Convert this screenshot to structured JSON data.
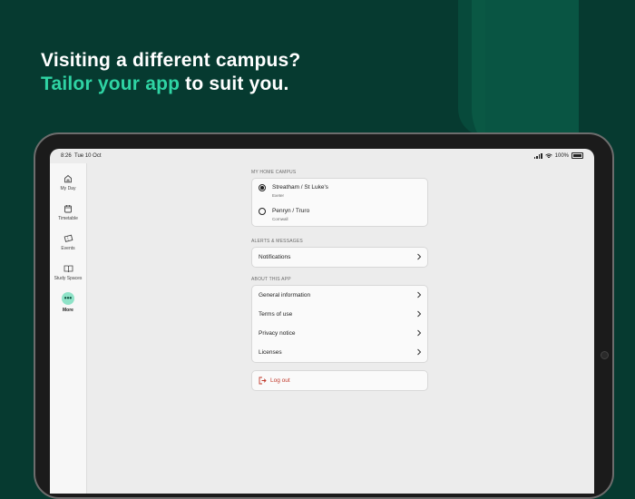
{
  "headline": {
    "line1": "Visiting a different campus?",
    "accent": "Tailor your app",
    "line2_rest": " to suit you."
  },
  "statusbar": {
    "time": "8:26",
    "date": "Tue 10 Oct",
    "battery": "100%"
  },
  "sidebar": {
    "items": [
      {
        "label": "My Day",
        "icon": "home-icon"
      },
      {
        "label": "Timetable",
        "icon": "calendar-icon"
      },
      {
        "label": "Events",
        "icon": "ticket-icon"
      },
      {
        "label": "Study Spaces",
        "icon": "book-icon"
      },
      {
        "label": "More",
        "icon": "more-icon",
        "active": true
      }
    ],
    "more_glyph": "•••"
  },
  "home_campus": {
    "label": "MY HOME CAMPUS",
    "options": [
      {
        "title": "Streatham / St Luke's",
        "subtitle": "Exeter",
        "selected": true
      },
      {
        "title": "Penryn / Truro",
        "subtitle": "Cornwall",
        "selected": false
      }
    ]
  },
  "alerts": {
    "label": "ALERTS & MESSAGES",
    "items": [
      {
        "label": "Notifications"
      }
    ]
  },
  "about": {
    "label": "ABOUT THIS APP",
    "items": [
      {
        "label": "General information"
      },
      {
        "label": "Terms of use"
      },
      {
        "label": "Privacy notice"
      },
      {
        "label": "Licenses"
      }
    ]
  },
  "logout": {
    "label": "Log out"
  },
  "colors": {
    "accent": "#2fd4a4",
    "background": "#063a30",
    "logout": "#c0392b"
  }
}
